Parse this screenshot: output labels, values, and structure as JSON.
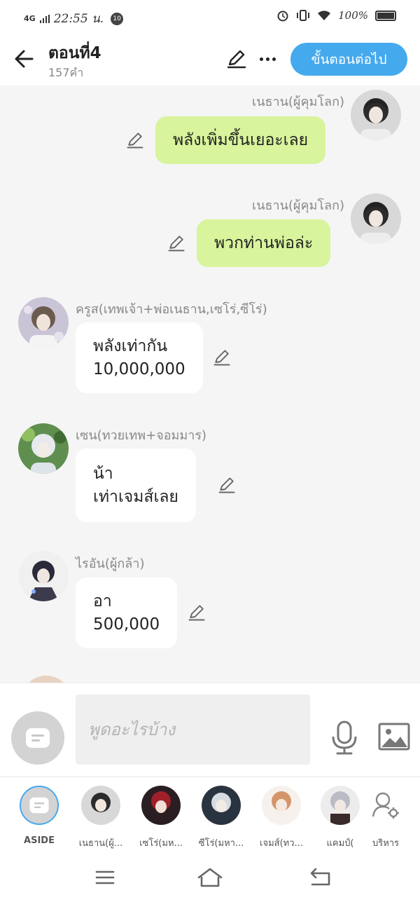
{
  "status": {
    "network": "4G",
    "time": "22:55 น.",
    "notification_badge": "10",
    "battery_percent": "100%"
  },
  "header": {
    "title": "ตอนที่4",
    "subtitle": "157คำ",
    "next_button": "ขั้นตอนต่อไป"
  },
  "messages": [
    {
      "sender": "เนธาน(ผู้คุมโลก)",
      "text": [
        "พลังเพิ่มขึ้นเยอะเลย"
      ],
      "side": "right",
      "bubble_color": "#d8f49c"
    },
    {
      "sender": "เนธาน(ผู้คุมโลก)",
      "text": [
        "พวกท่านพ่อล่ะ"
      ],
      "side": "right",
      "bubble_color": "#d8f49c"
    },
    {
      "sender": "ครูส(เทพเจ้า+พ่อเนธาน,เซโร่,ซีโร่)",
      "text": [
        "พลังเท่ากัน",
        "10,000,000"
      ],
      "side": "left",
      "bubble_color": "#ffffff"
    },
    {
      "sender": "เซน(ทวยเทพ+จอมมาร)",
      "text": [
        "น้า",
        "เท่าเจมส์เลย"
      ],
      "side": "left",
      "bubble_color": "#ffffff"
    },
    {
      "sender": "ไรอัน(ผู้กล้า)",
      "text": [
        "อา",
        "500,000"
      ],
      "side": "left",
      "bubble_color": "#ffffff"
    }
  ],
  "composer": {
    "placeholder": "พูดอะไรบ้าง"
  },
  "characters": [
    {
      "label": "ASIDE"
    },
    {
      "label": "เนธาน(ผู้..."
    },
    {
      "label": "เซโร่(มห..."
    },
    {
      "label": "ซีโร่(มหา..."
    },
    {
      "label": "เจมส์(ทว..."
    },
    {
      "label": "แคมป์("
    },
    {
      "label": "บริหาร"
    }
  ],
  "colors": {
    "accent": "#45a9ee",
    "outgoing_bubble": "#d8f49c",
    "incoming_bubble": "#ffffff",
    "background": "#f5f5f5"
  },
  "icons": [
    "back-arrow-icon",
    "pencil-icon",
    "more-icon",
    "aside-chat-icon",
    "microphone-icon",
    "image-icon",
    "manage-user-icon",
    "menu-icon",
    "home-icon",
    "return-icon"
  ]
}
